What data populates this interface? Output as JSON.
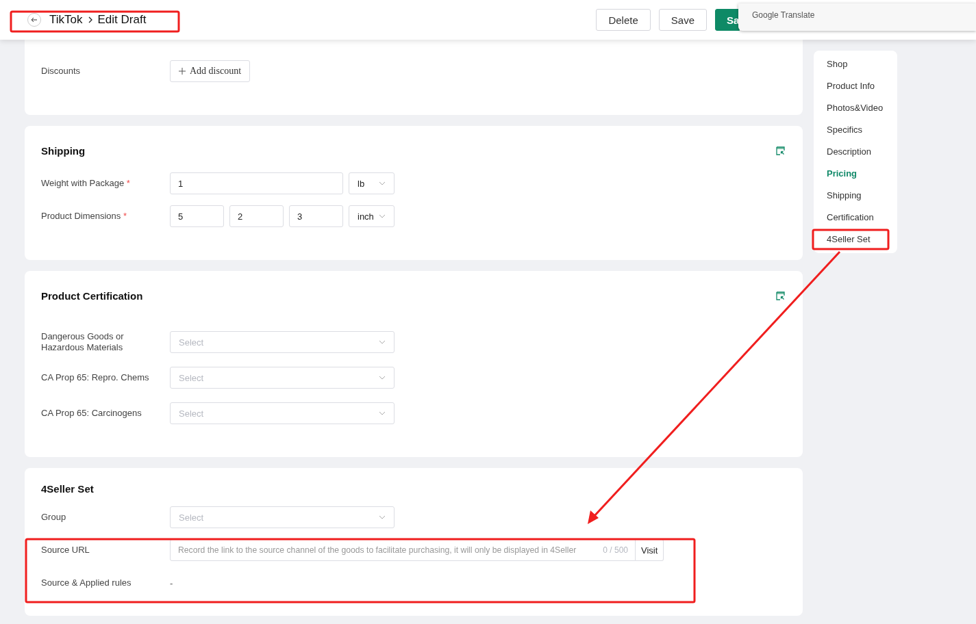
{
  "header": {
    "breadcrumb": [
      "TikTok",
      "Edit Draft"
    ],
    "buttons": [
      {
        "label": "Delete",
        "kind": "default"
      },
      {
        "label": "Save",
        "kind": "default"
      },
      {
        "label": "Sa",
        "kind": "primary"
      }
    ]
  },
  "translate_popup": {
    "label": "Google Translate"
  },
  "sections": [
    {
      "fields": [
        {
          "label": "Discounts",
          "kind": "button",
          "button": "Add discount"
        }
      ]
    },
    {
      "title": "Shipping",
      "jump_icon": true,
      "fields": [
        {
          "label": "Weight with Package",
          "required_mark": "*",
          "kind": "input",
          "values": [
            "1"
          ],
          "unit": "lb"
        },
        {
          "label": "Product Dimensions",
          "required_mark": "*",
          "kind": "input",
          "values": [
            "5",
            "2",
            "3"
          ],
          "unit": "inch"
        }
      ]
    },
    {
      "title": "Product Certification",
      "jump_icon": true,
      "fields": [
        {
          "label": "Dangerous Goods or\nHazardous Materials",
          "kind": "select",
          "placeholder": "Select"
        },
        {
          "label": "CA Prop 65: Repro. Chems",
          "kind": "select",
          "placeholder": "Select"
        },
        {
          "label": "CA Prop 65: Carcinogens",
          "kind": "select",
          "placeholder": "Select"
        }
      ]
    },
    {
      "title": "4Seller Set",
      "jump_icon": false,
      "fields": [
        {
          "label": "Group",
          "kind": "select",
          "placeholder": "Select"
        },
        {
          "label": "Source URL",
          "kind": "url",
          "placeholder": "Record the link to the source channel of the goods to facilitate purchasing, it will only be displayed in 4Seller",
          "counter": "0 / 500",
          "button": "Visit"
        },
        {
          "label": "Source & Applied rules",
          "kind": "text",
          "value": "-"
        }
      ]
    }
  ],
  "nav": [
    {
      "label": "Shop",
      "selected": false
    },
    {
      "label": "Product Info",
      "selected": false
    },
    {
      "label": "Photos&Video",
      "selected": false
    },
    {
      "label": "Specifics",
      "selected": false
    },
    {
      "label": "Description",
      "selected": false
    },
    {
      "label": "Pricing",
      "selected": true
    },
    {
      "label": "Shipping",
      "selected": false
    },
    {
      "label": "Certification",
      "selected": false
    },
    {
      "label": "4Seller Set",
      "selected": false
    }
  ]
}
